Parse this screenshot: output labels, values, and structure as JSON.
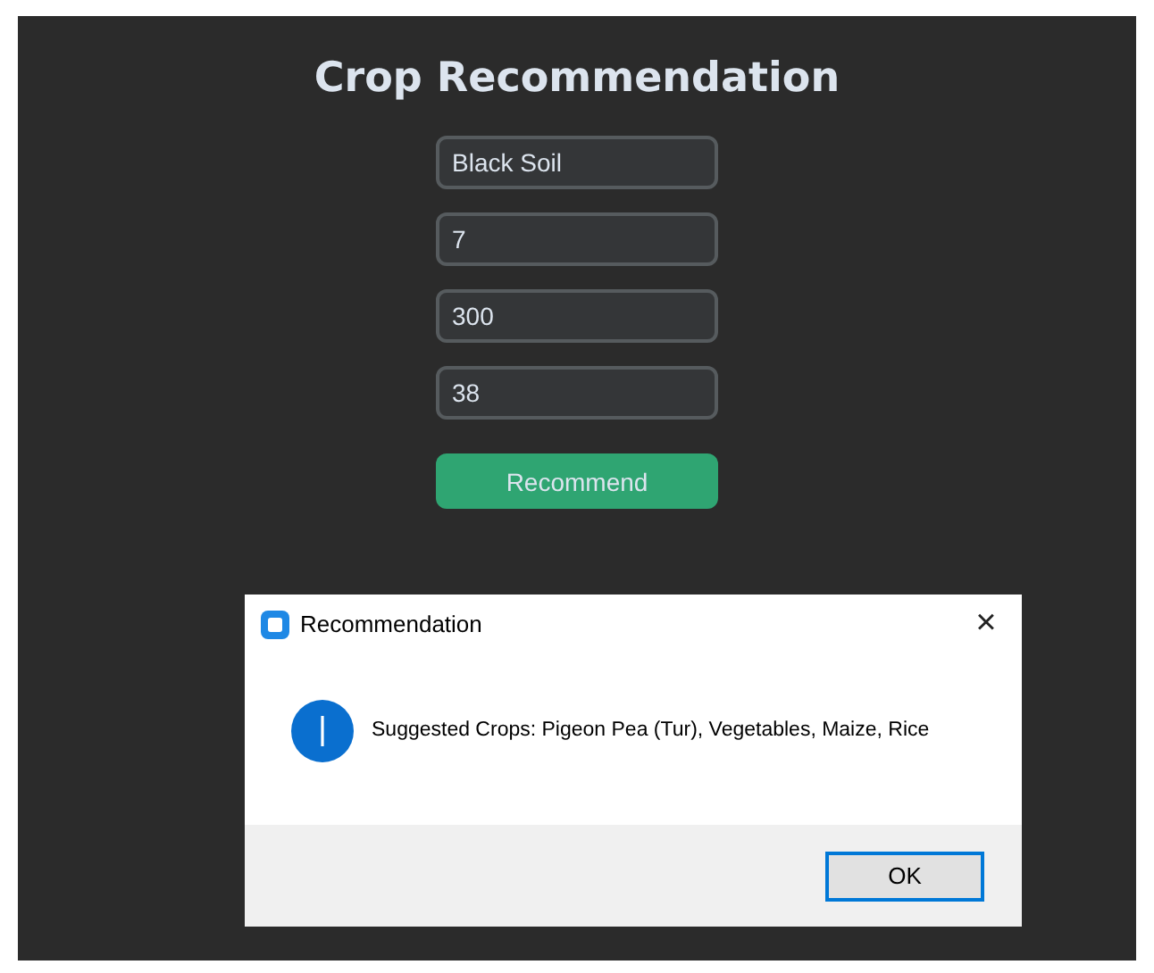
{
  "title": "Crop Recommendation",
  "fields": [
    {
      "value": "Black Soil"
    },
    {
      "value": "7"
    },
    {
      "value": "300"
    },
    {
      "value": "38"
    }
  ],
  "recommend_button": "Recommend",
  "dialog": {
    "title": "Recommendation",
    "close": "×",
    "message": "Suggested Crops: Pigeon Pea (Tur), Vegetables, Maize, Rice",
    "buttons": [
      "OK"
    ]
  }
}
